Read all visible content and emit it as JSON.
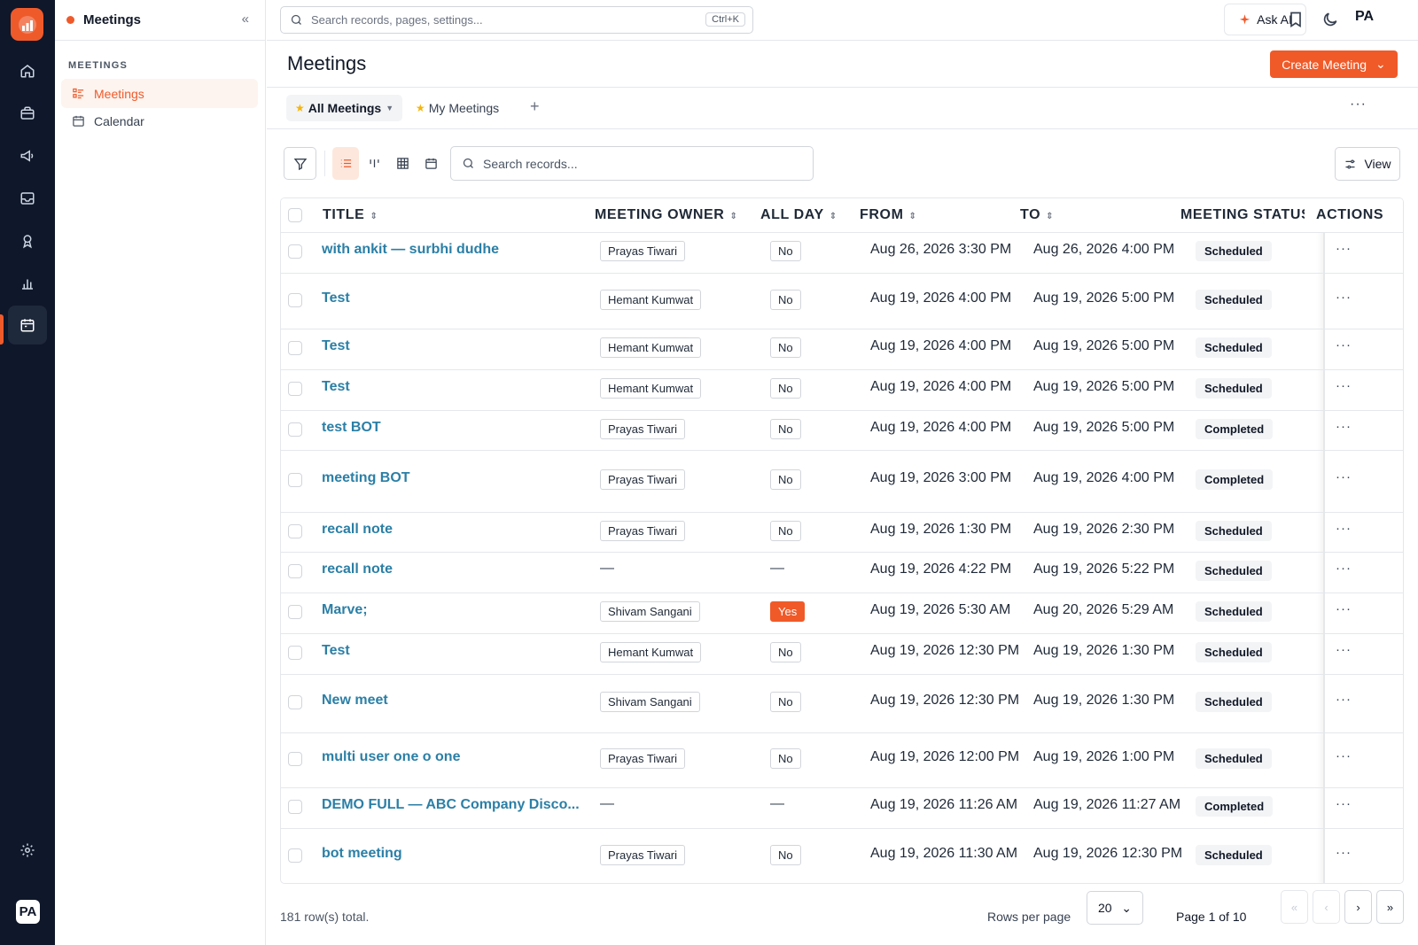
{
  "sidebar": {
    "title": "Meetings",
    "section_label": "MEETINGS",
    "items": [
      {
        "label": "Meetings"
      },
      {
        "label": "Calendar"
      }
    ]
  },
  "rail": {
    "avatar": "PA",
    "icons": [
      "home-icon",
      "briefcase-icon",
      "megaphone-icon",
      "inbox-icon",
      "award-icon",
      "bar-chart-icon",
      "calendar-icon",
      "settings-icon"
    ]
  },
  "topbar": {
    "search_placeholder": "Search records, pages, settings...",
    "shortcut": "Ctrl+K",
    "ask_ai": "Ask AI",
    "avatar": "PA"
  },
  "page": {
    "title": "Meetings",
    "create_button": "Create Meeting"
  },
  "tabs": [
    {
      "label": "All Meetings"
    },
    {
      "label": "My Meetings"
    }
  ],
  "toolbar": {
    "search_placeholder": "Search records...",
    "view_label": "View"
  },
  "table": {
    "headers": {
      "title": "TITLE",
      "owner": "MEETING OWNER",
      "all_day": "ALL DAY",
      "from": "FROM",
      "to": "TO",
      "status": "MEETING STATUS",
      "actions": "ACTIONS"
    },
    "rows": [
      {
        "title": "with ankit — surbhi dudhe",
        "owner": "Prayas Tiwari",
        "all_day": "No",
        "from": "Aug 26, 2026 3:30 PM",
        "to": "Aug 26, 2026 4:00 PM",
        "status": "Scheduled"
      },
      {
        "title": "Test",
        "owner": "Hemant Kumwat",
        "all_day": "No",
        "from": "Aug 19, 2026 4:00 PM",
        "to": "Aug 19, 2026 5:00 PM",
        "status": "Scheduled"
      },
      {
        "title": "Test",
        "owner": "Hemant Kumwat",
        "all_day": "No",
        "from": "Aug 19, 2026 4:00 PM",
        "to": "Aug 19, 2026 5:00 PM",
        "status": "Scheduled"
      },
      {
        "title": "Test",
        "owner": "Hemant Kumwat",
        "all_day": "No",
        "from": "Aug 19, 2026 4:00 PM",
        "to": "Aug 19, 2026 5:00 PM",
        "status": "Scheduled"
      },
      {
        "title": "test BOT",
        "owner": "Prayas Tiwari",
        "all_day": "No",
        "from": "Aug 19, 2026 4:00 PM",
        "to": "Aug 19, 2026 5:00 PM",
        "status": "Completed"
      },
      {
        "title": "meeting BOT",
        "owner": "Prayas Tiwari",
        "all_day": "No",
        "from": "Aug 19, 2026 3:00 PM",
        "to": "Aug 19, 2026 4:00 PM",
        "status": "Completed"
      },
      {
        "title": "recall note",
        "owner": "Prayas Tiwari",
        "all_day": "No",
        "from": "Aug 19, 2026 1:30 PM",
        "to": "Aug 19, 2026 2:30 PM",
        "status": "Scheduled"
      },
      {
        "title": "recall note",
        "owner": "—",
        "all_day": "—",
        "from": "Aug 19, 2026 4:22 PM",
        "to": "Aug 19, 2026 5:22 PM",
        "status": "Scheduled"
      },
      {
        "title": "Marve;",
        "owner": "Shivam Sangani",
        "all_day": "Yes",
        "from": "Aug 19, 2026 5:30 AM",
        "to": "Aug 20, 2026 5:29 AM",
        "status": "Scheduled"
      },
      {
        "title": "Test",
        "owner": "Hemant Kumwat",
        "all_day": "No",
        "from": "Aug 19, 2026 12:30 PM",
        "to": "Aug 19, 2026 1:30 PM",
        "status": "Scheduled"
      },
      {
        "title": "New meet",
        "owner": "Shivam Sangani",
        "all_day": "No",
        "from": "Aug 19, 2026 12:30 PM",
        "to": "Aug 19, 2026 1:30 PM",
        "status": "Scheduled"
      },
      {
        "title": "multi user one o one",
        "owner": "Prayas Tiwari",
        "all_day": "No",
        "from": "Aug 19, 2026 12:00 PM",
        "to": "Aug 19, 2026 1:00 PM",
        "status": "Scheduled"
      },
      {
        "title": "DEMO FULL — ABC Company Disco...",
        "owner": "—",
        "all_day": "—",
        "from": "Aug 19, 2026 11:26 AM",
        "to": "Aug 19, 2026 11:27 AM",
        "status": "Completed"
      },
      {
        "title": "bot meeting",
        "owner": "Prayas Tiwari",
        "all_day": "No",
        "from": "Aug 19, 2026 11:30 AM",
        "to": "Aug 19, 2026 12:30 PM",
        "status": "Scheduled"
      }
    ]
  },
  "footer": {
    "total": "181 row(s) total.",
    "rows_per_page_label": "Rows per page",
    "rows_per_page": "20",
    "page_info": "Page 1 of 10"
  },
  "colors": {
    "accent": "#f05a28",
    "rail_bg": "#0f172a",
    "link": "#2b7fa6"
  }
}
